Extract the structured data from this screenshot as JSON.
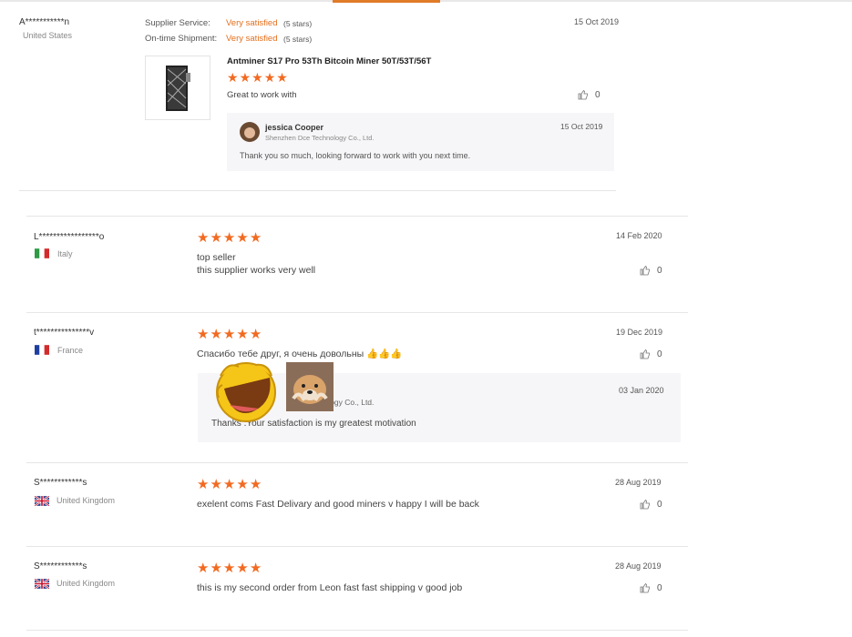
{
  "first_review": {
    "name": "A***********n",
    "country": "United States",
    "supplier_service_label": "Supplier Service:",
    "supplier_service_value": "Very satisfied",
    "supplier_service_stars": "(5 stars)",
    "shipment_label": "On-time Shipment:",
    "shipment_value": "Very satisfied",
    "shipment_stars": "(5 stars)",
    "date": "15 Oct 2019",
    "product_title": "Antminer S17 Pro 53Th Bitcoin Miner 50T/53T/56T",
    "rating": 5,
    "comment": "Great to work with",
    "likes": "0",
    "reply": {
      "name": "jessica Cooper",
      "company": "Shenzhen Dce Technology Co., Ltd.",
      "date": "15 Oct 2019",
      "text": "Thank you so much, looking forward to work with you next time."
    }
  },
  "reviews": [
    {
      "name": "L*****************o",
      "country": "Italy",
      "date": "14 Feb 2020",
      "rating": 5,
      "text1": "top seller",
      "text2": "this supplier works very well",
      "likes": "0"
    },
    {
      "name": "t***************v",
      "country": "France",
      "date": "19 Dec 2019",
      "rating": 5,
      "text1": "Спасибо тебе друг, я очень довольны 👍👍👍",
      "likes": "0",
      "reply": {
        "company": "Li... Technology Co., Ltd.",
        "date": "03 Jan 2020",
        "text": "Thanks .Your satisfaction is my greatest motivation"
      }
    },
    {
      "name": "S************s",
      "country": "United Kingdom",
      "date": "28 Aug 2019",
      "rating": 5,
      "text1": "exelent coms Fast Delivary and good miners v happy I will be back",
      "likes": "0"
    },
    {
      "name": "S************s",
      "country": "United Kingdom",
      "date": "28 Aug 2019",
      "rating": 5,
      "text1": "this is my second order from Leon fast fast shipping v good job",
      "likes": "0"
    }
  ],
  "icons": {
    "star": "star-icon",
    "like": "thumbs-up-icon",
    "flag": "flag-icon"
  },
  "colors": {
    "accent": "#f26a21",
    "satisfied": "#e46e1b"
  }
}
